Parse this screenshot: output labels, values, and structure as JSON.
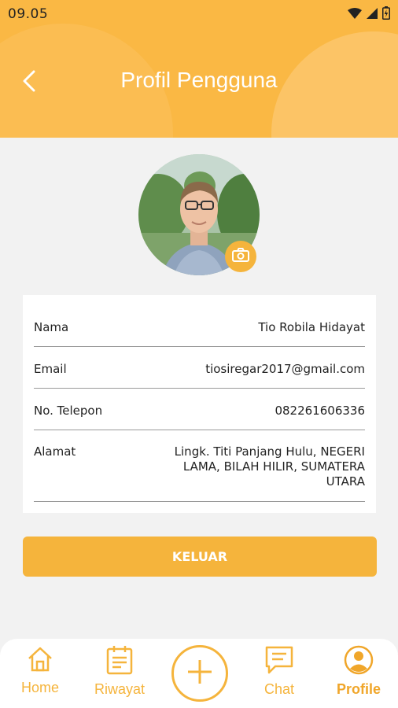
{
  "status_bar": {
    "time": "09.05"
  },
  "header": {
    "title": "Profil Pengguna"
  },
  "profile": {
    "fields": [
      {
        "label": "Nama",
        "value": "Tio Robila Hidayat"
      },
      {
        "label": "Email",
        "value": "tiosiregar2017@gmail.com"
      },
      {
        "label": "No. Telepon",
        "value": "082261606336"
      },
      {
        "label": "Alamat",
        "value_lines": [
          "Lingk. Titi Panjang Hulu, NEGERI",
          "LAMA, BILAH HILIR, SUMATERA",
          "UTARA"
        ]
      }
    ]
  },
  "actions": {
    "logout_label": "KELUAR"
  },
  "bottom_nav": {
    "items": [
      {
        "label": "Home",
        "icon": "home-icon"
      },
      {
        "label": "Riwayat",
        "icon": "clipboard-icon"
      },
      {
        "label": "",
        "icon": "plus-icon"
      },
      {
        "label": "Chat",
        "icon": "chat-icon"
      },
      {
        "label": "Profile",
        "icon": "user-circle-icon",
        "active": true
      }
    ]
  },
  "colors": {
    "accent": "#f5b43c",
    "header": "#fab844",
    "background": "#f2f2f2"
  }
}
